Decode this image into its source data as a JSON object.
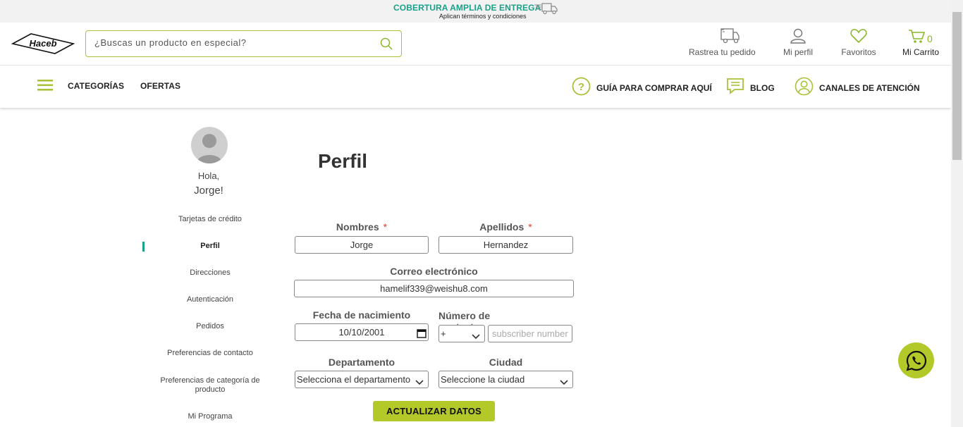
{
  "promo": {
    "title": "COBERTURA AMPLIA DE ENTREGA",
    "subtitle": "Aplican términos y condiciones"
  },
  "header": {
    "logo_text": "Haceb",
    "search_placeholder": "¿Buscas un producto en especial?",
    "track_label": "Rastrea tu pedido",
    "profile_label": "Mi perfil",
    "favorites_label": "Favoritos",
    "cart_label": "Mi Carrito",
    "cart_count": "0"
  },
  "nav": {
    "categories": "CATEGORÍAS",
    "offers": "OFERTAS",
    "guide": "GUÍA PARA COMPRAR AQUÍ",
    "blog": "BLOG",
    "channels": "CANALES DE ATENCIÓN"
  },
  "sidebar": {
    "greeting": "Hola,",
    "name": "Jorge!",
    "items": [
      {
        "label": "Tarjetas de crédito"
      },
      {
        "label": "Perfil"
      },
      {
        "label": "Direcciones"
      },
      {
        "label": "Autenticación"
      },
      {
        "label": "Pedidos"
      },
      {
        "label": "Preferencias de contacto"
      },
      {
        "label": "Preferencias de categoría de producto"
      },
      {
        "label": "Mi Programa"
      }
    ]
  },
  "profile": {
    "title": "Perfil",
    "required_mark": "*",
    "first_name_label": "Nombres",
    "first_name_value": "Jorge",
    "last_name_label": "Apellidos",
    "last_name_value": "Hernandez",
    "email_label": "Correo electrónico",
    "email_value": "hamelif339@weishu8.com",
    "birth_label": "Fecha de nacimiento",
    "birth_value": "10/10/2001",
    "phone_label": "Número de contacto",
    "phone_prefix": "+",
    "phone_placeholder": "subscriber number",
    "department_label": "Departamento",
    "department_value": "Selecciona el departamento",
    "city_label": "Ciudad",
    "city_value": "Seleccione la ciudad",
    "submit_label": "ACTUALIZAR DATOS"
  },
  "colors": {
    "accent_green": "#b3c92a",
    "teal": "#1aa189",
    "required_red": "#e03a2c"
  }
}
